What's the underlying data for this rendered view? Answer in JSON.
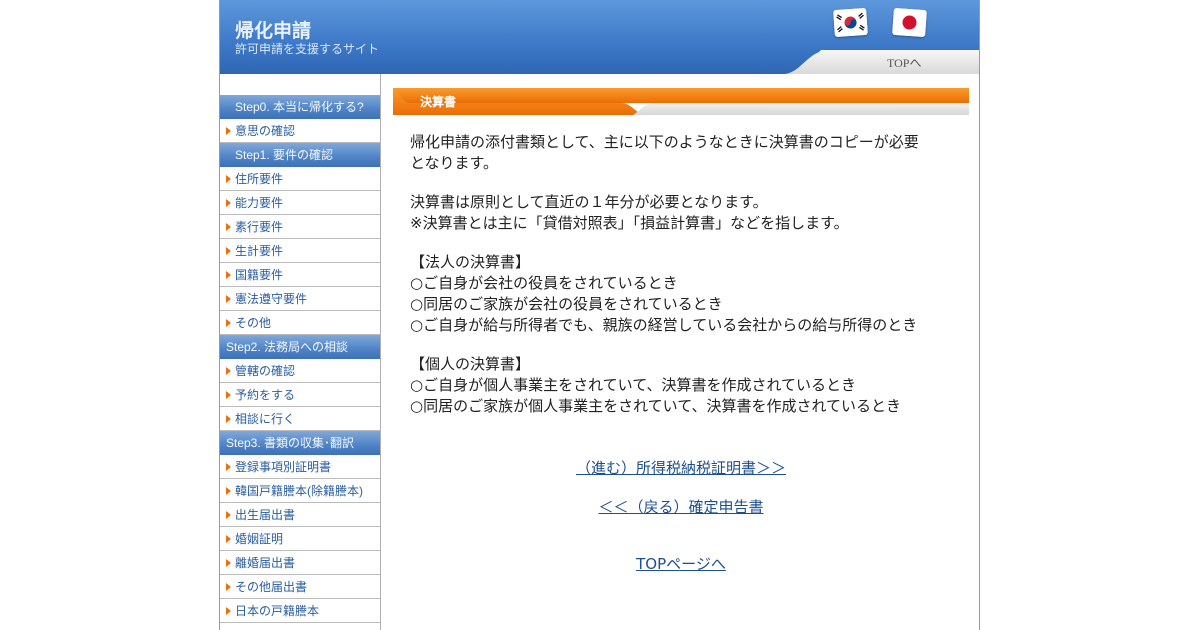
{
  "header": {
    "site_title": "帰化申請",
    "site_subtitle": "許可申請を支援するサイト",
    "top_link": "TOPへ",
    "flags": [
      {
        "name": "korea-flag-icon"
      },
      {
        "name": "japan-flag-icon"
      }
    ]
  },
  "sidebar": {
    "groups": [
      {
        "heading": "Step0. 本当に帰化する?",
        "items": [
          "意思の確認"
        ]
      },
      {
        "heading": "Step1. 要件の確認",
        "items": [
          "住所要件",
          "能力要件",
          "素行要件",
          "生計要件",
          "国籍要件",
          "憲法遵守要件",
          "その他"
        ]
      },
      {
        "heading": "Step2. 法務局への相談",
        "items": [
          "管轄の確認",
          "予約をする",
          "相談に行く"
        ]
      },
      {
        "heading": "Step3. 書類の収集･翻訳",
        "items": [
          "登録事項別証明書",
          "韓国戸籍謄本(除籍謄本)",
          "出生届出書",
          "婚姻証明",
          "離婚届出書",
          "その他届出書",
          "日本の戸籍謄本"
        ]
      }
    ]
  },
  "main": {
    "section_title": "決算書",
    "paragraphs": [
      [
        "帰化申請の添付書類として、主に以下のようなときに決算書のコピーが必要",
        "となります。"
      ],
      [
        "決算書は原則として直近の１年分が必要となります。",
        "※決算書とは主に「貸借対照表」「損益計算書」などを指します。"
      ],
      [
        "【法人の決算書】",
        "○ご自身が会社の役員をされているとき",
        "○同居のご家族が会社の役員をされているとき",
        "○ご自身が給与所得者でも、親族の経営している会社からの給与所得のとき"
      ],
      [
        "【個人の決算書】",
        "○ご自身が個人事業主をされていて、決算書を作成されているとき",
        "○同居のご家族が個人事業主をされていて、決算書を作成されているとき"
      ]
    ],
    "next_link": "（進む）所得税納税証明書＞＞",
    "prev_link": "＜＜（戻る）確定申告書",
    "top_page_link": "TOPページへ"
  },
  "colors": {
    "header_blue": "#3f7bc9",
    "sidebar_heading_blue": "#4f83c6",
    "section_orange": "#f07e10",
    "link_blue": "#1d4f8f",
    "arrow_orange": "#e8700d"
  }
}
